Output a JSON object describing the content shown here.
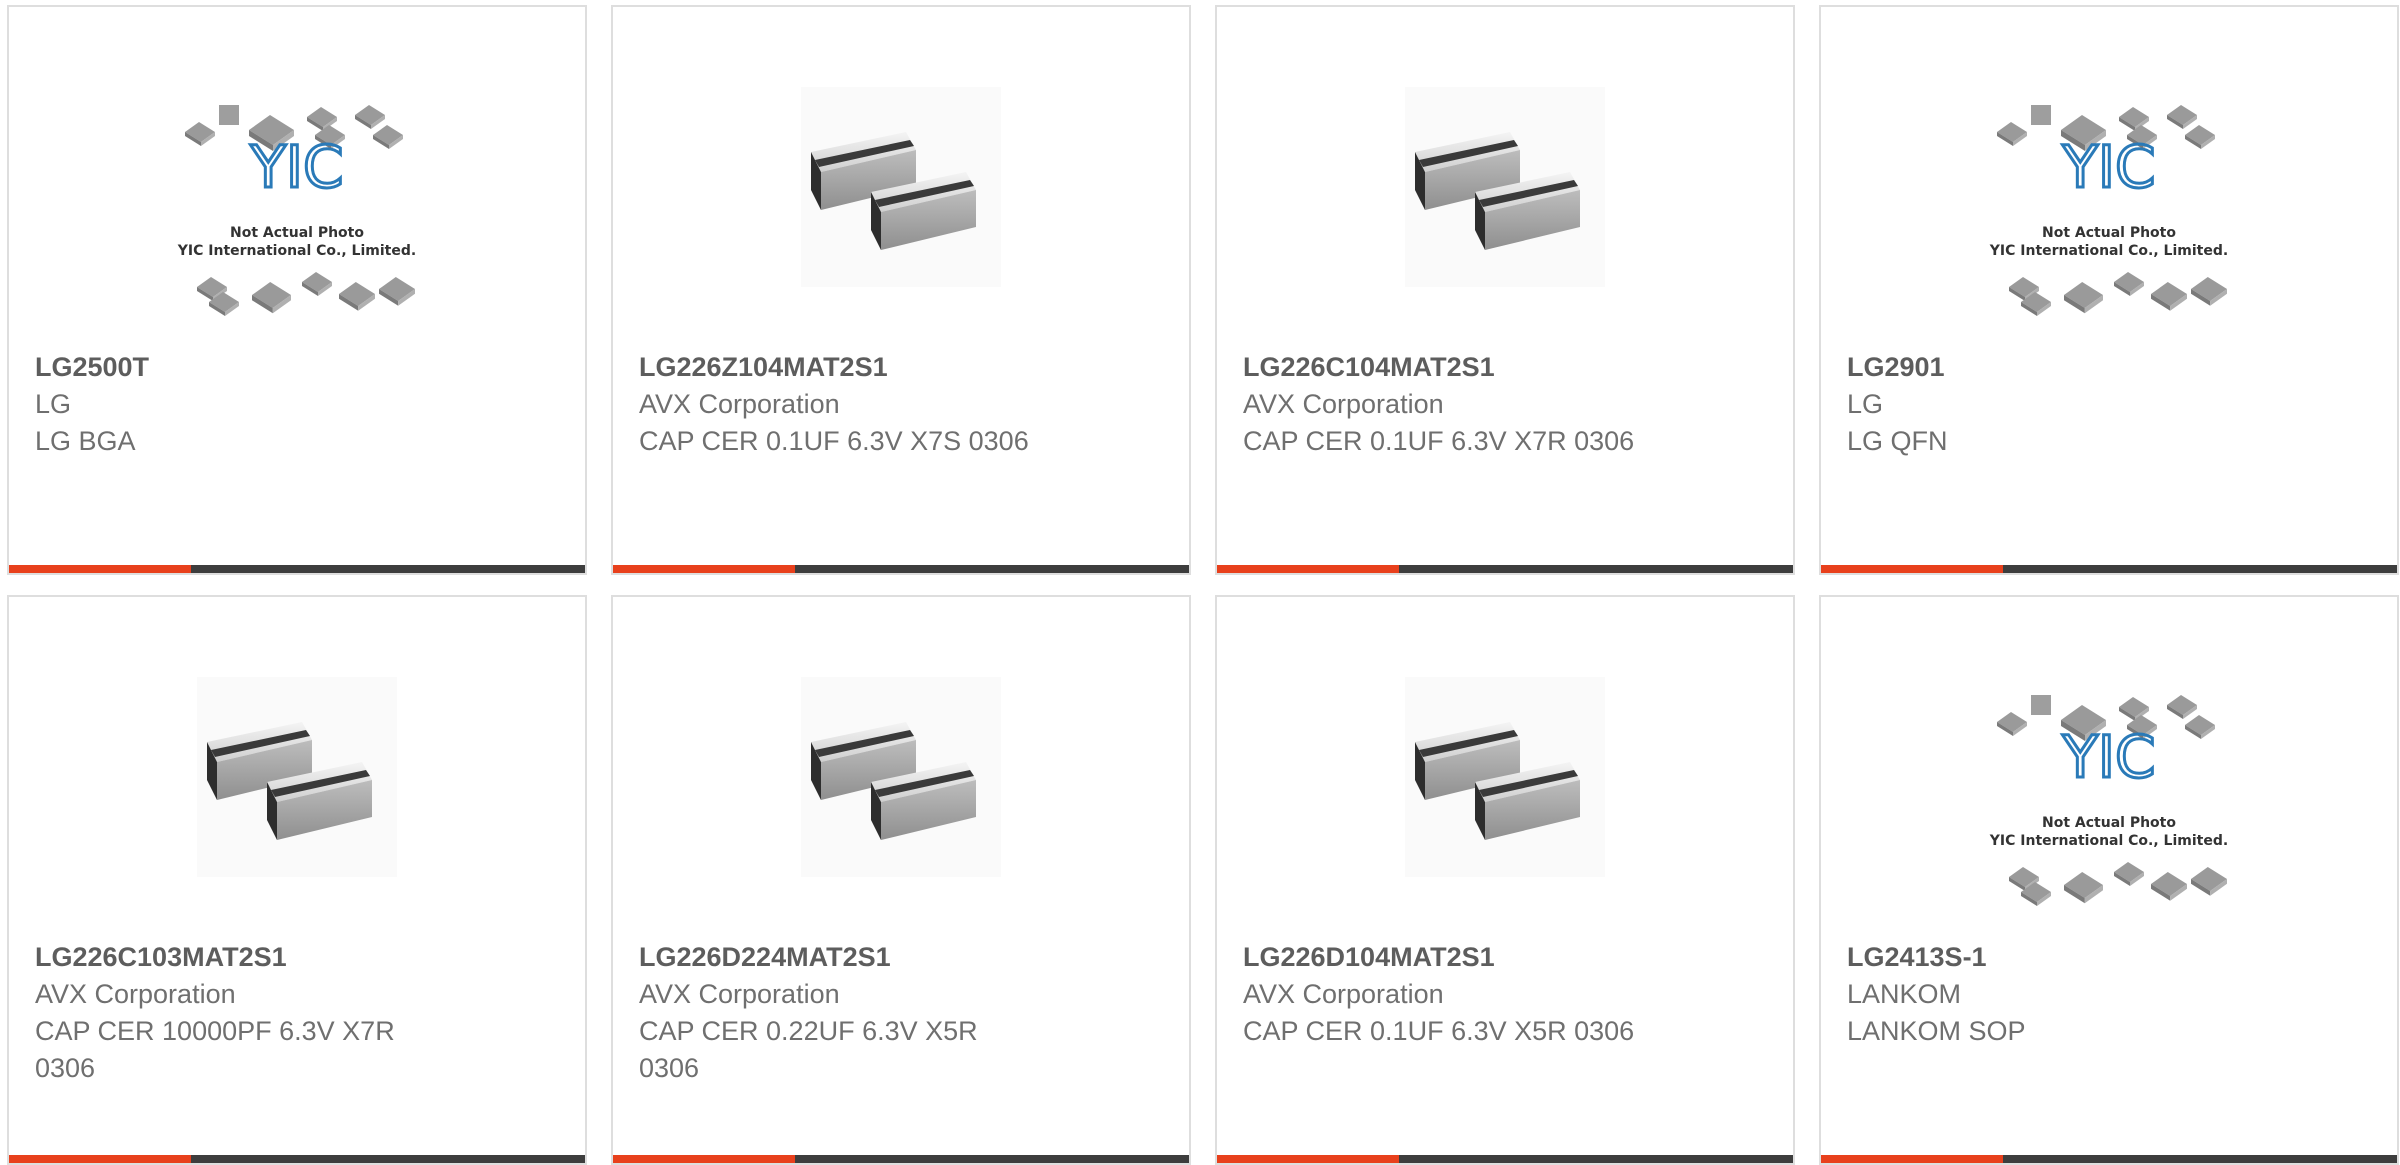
{
  "accent_color": "#e8401c",
  "bar_color": "#3d3d3d",
  "placeholder": {
    "line1": "Not Actual Photo",
    "line2": "YIC International Co., Limited.",
    "logo": "YIC"
  },
  "products": [
    {
      "part": "LG2500T",
      "manufacturer": "LG",
      "description": "LG BGA",
      "image": "not-actual-photo-placeholder"
    },
    {
      "part": "LG226Z104MAT2S1",
      "manufacturer": "AVX Corporation",
      "description": "CAP CER 0.1UF 6.3V X7S 0306",
      "image": "ceramic-capacitor-chip"
    },
    {
      "part": "LG226C104MAT2S1",
      "manufacturer": "AVX Corporation",
      "description": "CAP CER 0.1UF 6.3V X7R 0306",
      "image": "ceramic-capacitor-chip"
    },
    {
      "part": "LG2901",
      "manufacturer": "LG",
      "description": "LG QFN",
      "image": "not-actual-photo-placeholder"
    },
    {
      "part": "LG226C103MAT2S1",
      "manufacturer": "AVX Corporation",
      "description": "CAP CER 10000PF 6.3V X7R 0306",
      "image": "ceramic-capacitor-chip"
    },
    {
      "part": "LG226D224MAT2S1",
      "manufacturer": "AVX Corporation",
      "description": "CAP CER 0.22UF 6.3V X5R 0306",
      "image": "ceramic-capacitor-chip"
    },
    {
      "part": "LG226D104MAT2S1",
      "manufacturer": "AVX Corporation",
      "description": "CAP CER 0.1UF 6.3V X5R 0306",
      "image": "ceramic-capacitor-chip"
    },
    {
      "part": "LG2413S-1",
      "manufacturer": "LANKOM",
      "description": "LANKOM SOP",
      "image": "not-actual-photo-placeholder"
    }
  ]
}
